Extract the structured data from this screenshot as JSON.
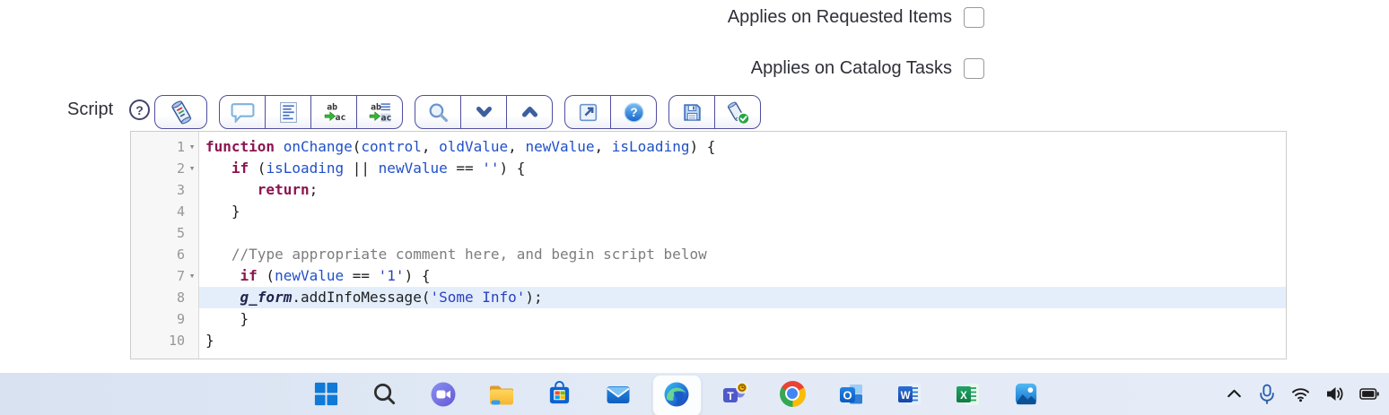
{
  "form": {
    "script_label": "Script",
    "help_icon_glyph": "?",
    "fields": [
      {
        "label": "Applies on Requested Items",
        "checked": false
      },
      {
        "label": "Applies on Catalog Tasks",
        "checked": false
      }
    ]
  },
  "toolbar": {
    "help_icon_glyph": "?",
    "buttons": [
      "syntax-editor-toggle",
      "toggle-comment",
      "format-code",
      "replace",
      "replace-all",
      "search",
      "find-next",
      "find-previous",
      "open-fullscreen",
      "help",
      "save",
      "validate-syntax"
    ],
    "replace_icon_text": {
      "top": "ab",
      "bottom": "ac"
    }
  },
  "editor": {
    "colors": {
      "keyword": "#8b1550",
      "identifier": "#2050c8",
      "string": "#2a3fc0",
      "comment": "#7d7d7d",
      "plain": "#1f1f1f",
      "g_form": "#23234d",
      "active_line_bg": "#e4eefb",
      "gutter_bg": "#f7f7f7"
    },
    "lines": [
      {
        "num": 1,
        "fold": true,
        "tokens": [
          [
            "kw",
            "function"
          ],
          [
            "pl",
            " "
          ],
          [
            "id",
            "onChange"
          ],
          [
            "pl",
            "("
          ],
          [
            "id",
            "control"
          ],
          [
            "pl",
            ", "
          ],
          [
            "id",
            "oldValue"
          ],
          [
            "pl",
            ", "
          ],
          [
            "id",
            "newValue"
          ],
          [
            "pl",
            ", "
          ],
          [
            "id",
            "isLoading"
          ],
          [
            "pl",
            ") {"
          ]
        ]
      },
      {
        "num": 2,
        "fold": true,
        "tokens": [
          [
            "pl",
            "   "
          ],
          [
            "kw",
            "if"
          ],
          [
            "pl",
            " ("
          ],
          [
            "id",
            "isLoading"
          ],
          [
            "pl",
            " || "
          ],
          [
            "id",
            "newValue"
          ],
          [
            "pl",
            " == "
          ],
          [
            "st",
            "''"
          ],
          [
            "pl",
            ") {"
          ]
        ]
      },
      {
        "num": 3,
        "tokens": [
          [
            "pl",
            "      "
          ],
          [
            "kw",
            "return"
          ],
          [
            "pl",
            ";"
          ]
        ]
      },
      {
        "num": 4,
        "tokens": [
          [
            "pl",
            "   }"
          ]
        ]
      },
      {
        "num": 5,
        "tokens": []
      },
      {
        "num": 6,
        "tokens": [
          [
            "pl",
            "   "
          ],
          [
            "cm",
            "//Type appropriate comment here, and begin script below"
          ]
        ]
      },
      {
        "num": 7,
        "fold": true,
        "tokens": [
          [
            "pl",
            "    "
          ],
          [
            "kw",
            "if"
          ],
          [
            "pl",
            " ("
          ],
          [
            "id",
            "newValue"
          ],
          [
            "pl",
            " == "
          ],
          [
            "st",
            "'1'"
          ],
          [
            "pl",
            ") {"
          ]
        ]
      },
      {
        "num": 8,
        "active": true,
        "tokens": [
          [
            "pl",
            "    "
          ],
          [
            "gf",
            "g_form"
          ],
          [
            "pl",
            ".addInfoMessage("
          ],
          [
            "st",
            "'Some Info'"
          ],
          [
            "pl",
            ");"
          ]
        ]
      },
      {
        "num": 9,
        "tokens": [
          [
            "pl",
            "    }"
          ]
        ]
      },
      {
        "num": 10,
        "tokens": [
          [
            "pl",
            "}"
          ]
        ]
      }
    ]
  },
  "taskbar": {
    "apps": [
      "start",
      "search",
      "chat",
      "file-explorer",
      "microsoft-store",
      "mail",
      "edge",
      "teams",
      "chrome",
      "outlook",
      "word",
      "excel",
      "photos"
    ],
    "active_app": "edge",
    "teams_badge": "away-clock",
    "tray": [
      "hidden-icons-chevron",
      "microphone",
      "wifi",
      "volume",
      "battery"
    ]
  }
}
